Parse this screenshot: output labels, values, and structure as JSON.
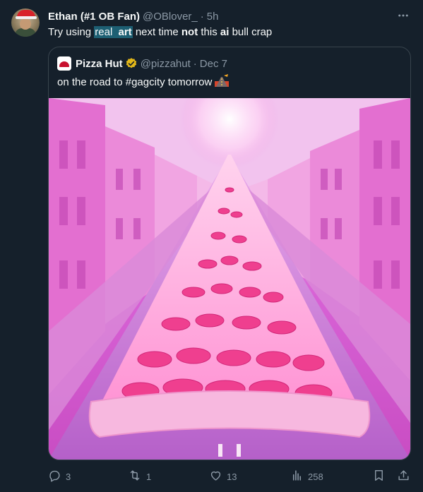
{
  "tweet": {
    "author_name": "Ethan (#1 OB Fan)",
    "handle": "@OBlover_",
    "separator": "·",
    "time": "5h",
    "text_parts": [
      "Try using ",
      "real",
      " ",
      "art",
      " next time ",
      "not",
      " this ",
      "ai",
      " bull crap"
    ],
    "highlight_color": "#1d5f73"
  },
  "quoted": {
    "author_name": "Pizza Hut",
    "handle": "@pizzahut",
    "separator": "·",
    "date": "Dec 7",
    "text": "on the road to #gagcity tomorrow",
    "emoji": "🛣️",
    "verified_color": "#e2b719"
  },
  "actions": {
    "replies": "3",
    "retweets": "1",
    "likes": "13",
    "views": "258"
  },
  "icons": {
    "more": "more-icon",
    "reply": "reply-icon",
    "retweet": "retweet-icon",
    "like": "heart-icon",
    "views": "views-icon",
    "bookmark": "bookmark-icon",
    "share": "share-icon"
  },
  "colors": {
    "background": "#15202b",
    "border": "#38444d",
    "muted": "#8b98a5",
    "text": "#f7f9f9"
  }
}
